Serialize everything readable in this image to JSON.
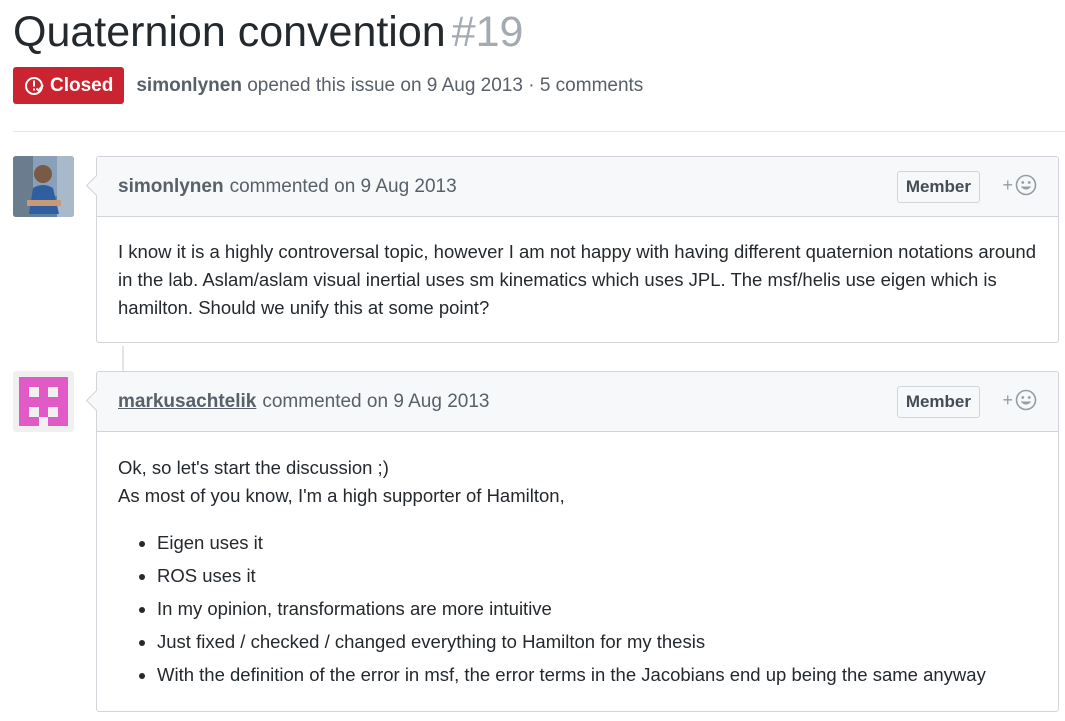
{
  "issue": {
    "title": "Quaternion convention",
    "number": "#19",
    "state": "Closed",
    "author": "simonlynen",
    "meta": "opened this issue on 9 Aug 2013 · 5 comments"
  },
  "comments": [
    {
      "author": "simonlynen",
      "when": "commented on 9 Aug 2013",
      "badge": "Member",
      "body": "I know it is a highly controversal topic, however I am not happy with having different quaternion notations around in the lab. Aslam/aslam visual inertial uses sm kinematics which uses JPL. The msf/helis use eigen which is hamilton. Should we unify this at some point?"
    },
    {
      "author": "markusachtelik",
      "when": "commented on 9 Aug 2013",
      "badge": "Member",
      "line1": "Ok, so let's start the discussion ;)",
      "line2": "As most of you know, I'm a high supporter of Hamilton,",
      "items": [
        "Eigen uses it",
        "ROS uses it",
        "In my opinion, transformations are more intuitive",
        "Just fixed / checked / changed everything to Hamilton for my thesis",
        "With the definition of the error in msf, the error terms in the Jacobians end up being the same anyway"
      ]
    }
  ],
  "colors": {
    "closed": "#cb2431",
    "identicon": "#e05bc6"
  }
}
